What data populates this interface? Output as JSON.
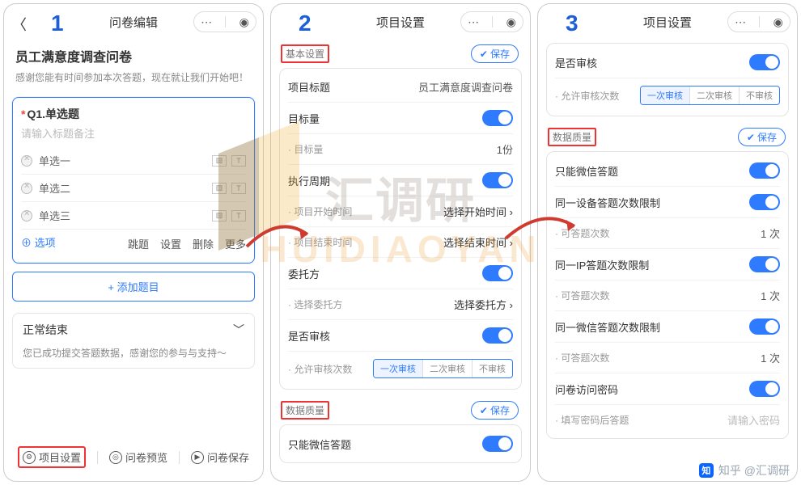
{
  "badges": {
    "p1": "1",
    "p2": "2",
    "p3": "3"
  },
  "nav": {
    "p1_title": "问卷编辑",
    "p23_title": "项目设置",
    "more": "⋯",
    "target": "◉"
  },
  "panel1": {
    "survey_title": "员工满意度调查问卷",
    "survey_desc": "感谢您能有时间参加本次答题，现在就让我们开始吧！",
    "q_label": "Q1.单选题",
    "placeholder": "请输入标题备注",
    "options": [
      "单选一",
      "单选二",
      "单选三"
    ],
    "add_option": "选项",
    "actions": [
      "跳题",
      "设置",
      "删除",
      "更多"
    ],
    "add_question": "+ 添加题目",
    "end_title": "正常结束",
    "end_msg": "您已成功提交答题数据，感谢您的参与与支持～",
    "bottom": {
      "settings": "项目设置",
      "preview": "问卷预览",
      "save": "问卷保存"
    }
  },
  "panel2": {
    "sec_basic": "基本设置",
    "save": "保存",
    "rows": {
      "proj_title_lbl": "项目标题",
      "proj_title_val": "员工满意度调查问卷",
      "target_qty_lbl": "目标量",
      "target_qty_sub_lbl": "· 目标量",
      "target_qty_sub_val": "1份",
      "period_lbl": "执行周期",
      "start_lbl": "· 项目开始时间",
      "start_val": "选择开始时间",
      "end_lbl": "· 项目结束时间",
      "end_val": "选择结束时间",
      "delegate_lbl": "委托方",
      "delegate_sel_lbl": "· 选择委托方",
      "delegate_sel_val": "选择委托方",
      "audit_lbl": "是否审核",
      "audit_times_lbl": "· 允许审核次数",
      "seg": [
        "一次审核",
        "二次审核",
        "不审核"
      ]
    },
    "sec_data": "数据质量",
    "wechat_only": "只能微信答题"
  },
  "panel3": {
    "audit_lbl": "是否审核",
    "audit_times_lbl": "· 允许审核次数",
    "seg": [
      "一次审核",
      "二次审核",
      "不审核"
    ],
    "sec_data": "数据质量",
    "save": "保存",
    "wechat_only": "只能微信答题",
    "same_device": "同一设备答题次数限制",
    "answer_count_lbl": "· 可答题次数",
    "answer_count_val": "1 次",
    "same_ip": "同一IP答题次数限制",
    "same_wechat": "同一微信答题次数限制",
    "pwd_lbl": "问卷访问密码",
    "pwd_sub_lbl": "· 填写密码后答题",
    "pwd_sub_val": "请输入密码"
  },
  "watermark": {
    "cn": "汇调研",
    "en": "HUIDIAOYAN"
  },
  "footer": "知乎 @汇调研"
}
